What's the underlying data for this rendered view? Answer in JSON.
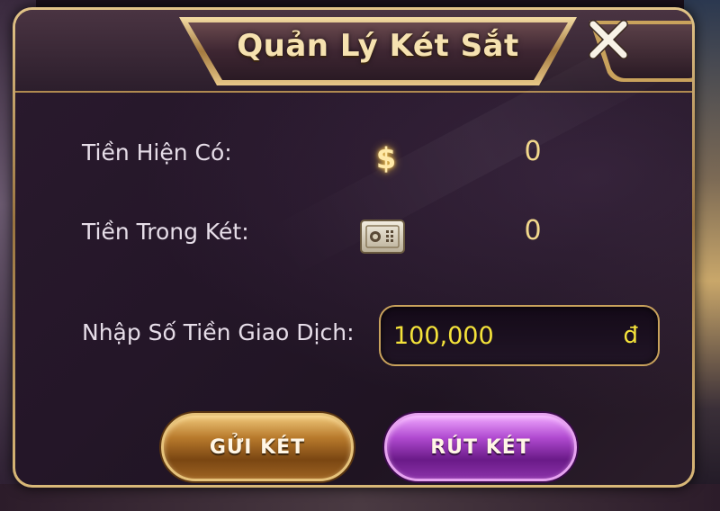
{
  "dialog": {
    "title": "Quản Lý Két Sắt",
    "close_label": "✕"
  },
  "rows": {
    "current_money_label": "Tiền Hiện Có:",
    "current_money_icon": "$",
    "current_money_value": "0",
    "safe_money_label": "Tiền Trong Két:",
    "safe_money_value": "0",
    "amount_label": "Nhập Số Tiền Giao Dịch:"
  },
  "amount_field": {
    "value": "100,000",
    "currency": "đ"
  },
  "buttons": {
    "deposit": "GỬI KÉT",
    "withdraw": "RÚT KÉT"
  },
  "icons": {
    "current_money": "dollar-icon",
    "safe_money": "safe-icon",
    "close": "close-icon"
  },
  "colors": {
    "gold_accent": "#e6c27a",
    "value_text": "#f2d88c",
    "input_text": "#f4e23a",
    "deposit_button": "#b87a2c",
    "withdraw_button": "#b04ad0"
  }
}
